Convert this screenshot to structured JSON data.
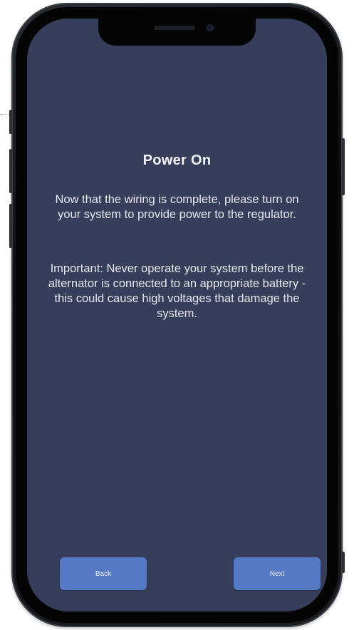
{
  "screen": {
    "title": "Power On",
    "paragraph_1": "Now that the wiring is complete, please turn on your system to provide power to the regulator.",
    "paragraph_2": "Important: Never operate your system before the alternator is connected to an appropriate battery - this could cause high voltages that damage the system."
  },
  "buttons": {
    "back_label": "Back",
    "next_label": "Next"
  },
  "colors": {
    "screen_background": "#373e5b",
    "button_background": "#5579c4",
    "text": "#e6e8ef"
  }
}
